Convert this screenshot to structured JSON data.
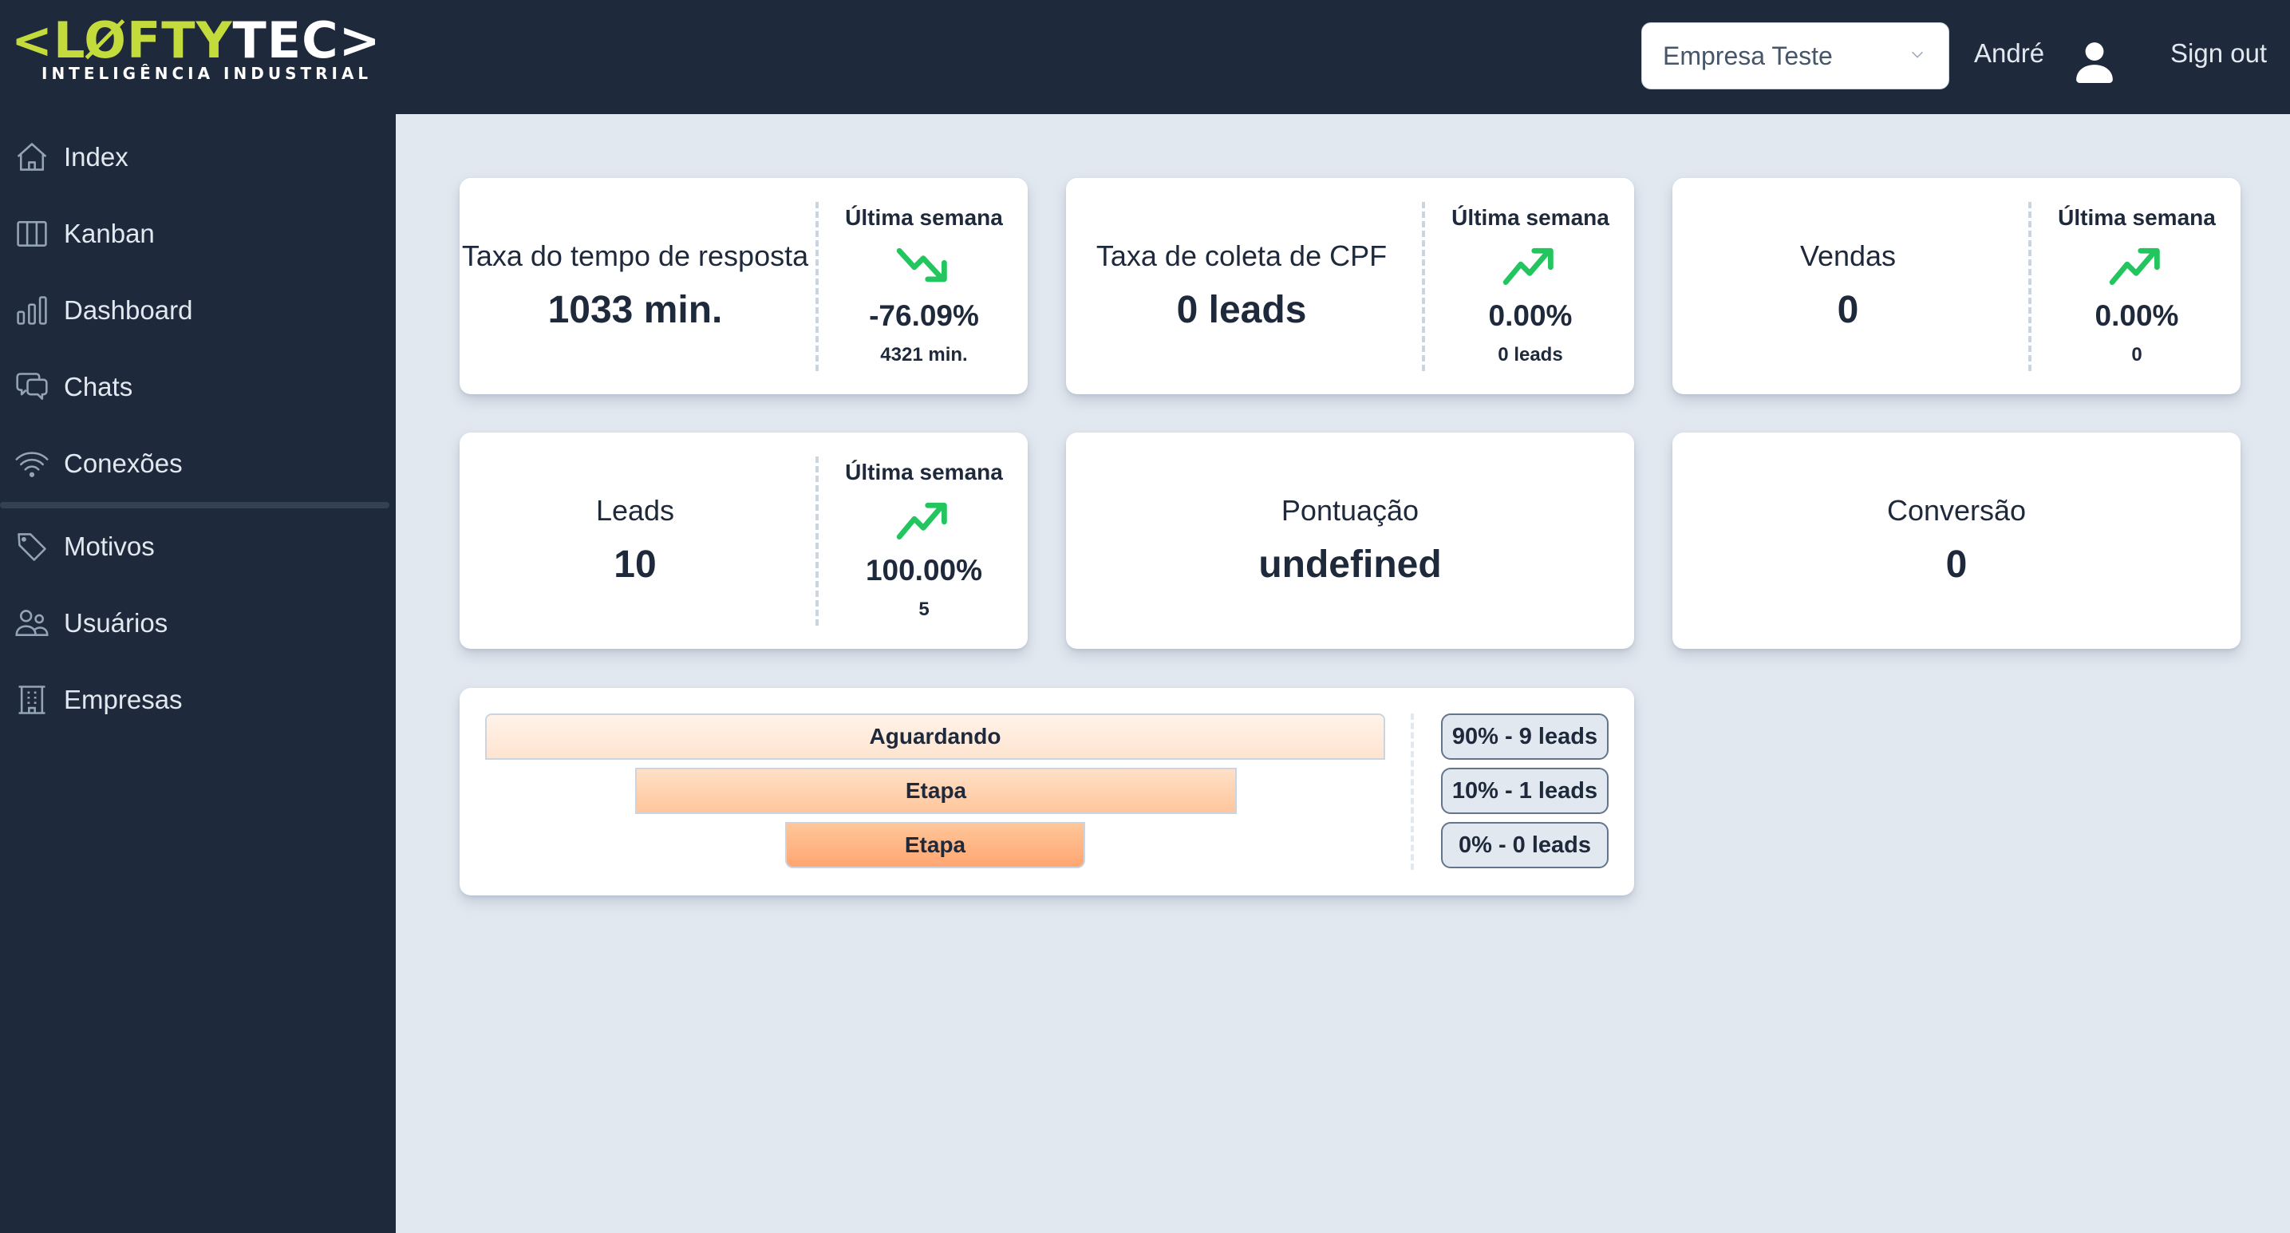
{
  "brand": {
    "logo_left": "<LØFTY",
    "logo_right": "TEC>",
    "tagline": "INTELIGÊNCIA INDUSTRIAL",
    "colors": {
      "lime": "#c4db3c",
      "navy": "#1e293b",
      "trend_green": "#22c55e"
    }
  },
  "header": {
    "company_select": {
      "value": "Empresa Teste",
      "icon": "chevron-down-icon"
    },
    "user_name": "André",
    "avatar_icon": "user-icon",
    "signout_label": "Sign out"
  },
  "sidebar": {
    "items": [
      {
        "label": "Index",
        "icon": "home-icon"
      },
      {
        "label": "Kanban",
        "icon": "columns-icon"
      },
      {
        "label": "Dashboard",
        "icon": "bar-chart-icon"
      },
      {
        "label": "Chats",
        "icon": "chat-bubbles-icon"
      },
      {
        "label": "Conexões",
        "icon": "wifi-icon"
      },
      {
        "label": "Motivos",
        "icon": "tag-icon"
      },
      {
        "label": "Usuários",
        "icon": "users-icon"
      },
      {
        "label": "Empresas",
        "icon": "building-icon"
      }
    ]
  },
  "metrics": [
    {
      "title": "Taxa do tempo de resposta",
      "value": "1033 min.",
      "week_label": "Última semana",
      "trend": "down",
      "pct": "-76.09%",
      "prev": "4321 min."
    },
    {
      "title": "Taxa de coleta de CPF",
      "value": "0 leads",
      "week_label": "Última semana",
      "trend": "up",
      "pct": "0.00%",
      "prev": "0 leads"
    },
    {
      "title": "Vendas",
      "value": "0",
      "week_label": "Última semana",
      "trend": "up",
      "pct": "0.00%",
      "prev": "0"
    },
    {
      "title": "Leads",
      "value": "10",
      "week_label": "Última semana",
      "trend": "up",
      "pct": "100.00%",
      "prev": "5"
    },
    {
      "title": "Pontuação",
      "value": "undefined"
    },
    {
      "title": "Conversão",
      "value": "0"
    }
  ],
  "funnel": {
    "stages": [
      {
        "label": "Aguardando",
        "badge": "90% - 9 leads",
        "percent": 90,
        "leads": 9
      },
      {
        "label": "Etapa",
        "badge": "10% - 1 leads",
        "percent": 10,
        "leads": 1
      },
      {
        "label": "Etapa",
        "badge": "0% - 0 leads",
        "percent": 0,
        "leads": 0
      }
    ]
  }
}
